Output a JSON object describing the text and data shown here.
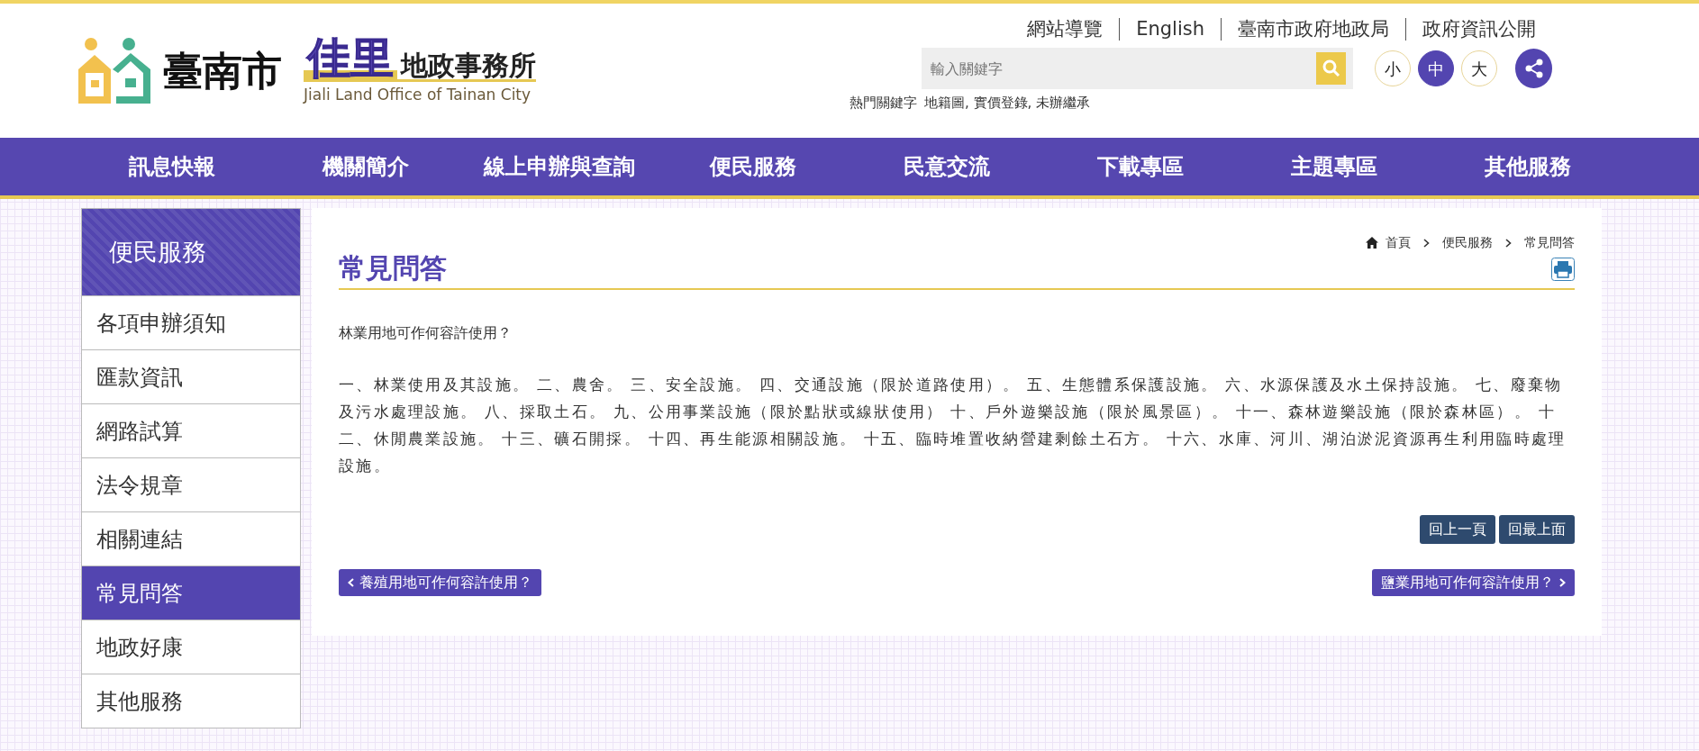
{
  "header": {
    "logo": {
      "city": "臺南市",
      "name_highlight": "佳里",
      "name_rest": "地政事務所",
      "english": "Jiali Land Office of Tainan City"
    },
    "top_links": [
      "網站導覽",
      "English",
      "臺南市政府地政局",
      "政府資訊公開"
    ],
    "search": {
      "placeholder": "輸入關鍵字"
    },
    "font_sizes": [
      {
        "label": "小",
        "selected": false
      },
      {
        "label": "中",
        "selected": true
      },
      {
        "label": "大",
        "selected": false
      }
    ],
    "hot_keywords": {
      "label": "熱門關鍵字",
      "keywords": "地籍圖, 實價登錄, 未辦繼承"
    }
  },
  "nav": [
    "訊息快報",
    "機關簡介",
    "線上申辦與查詢",
    "便民服務",
    "民意交流",
    "下載專區",
    "主題專區",
    "其他服務"
  ],
  "sidebar": {
    "title": "便民服務",
    "items": [
      {
        "label": "各項申辦須知",
        "selected": false
      },
      {
        "label": "匯款資訊",
        "selected": false
      },
      {
        "label": "網路試算",
        "selected": false
      },
      {
        "label": "法令規章",
        "selected": false
      },
      {
        "label": "相關連結",
        "selected": false
      },
      {
        "label": "常見問答",
        "selected": true
      },
      {
        "label": "地政好康",
        "selected": false
      },
      {
        "label": "其他服務",
        "selected": false
      }
    ]
  },
  "breadcrumb": [
    "首頁",
    "便民服務",
    "常見問答"
  ],
  "page_title": "常見問答",
  "question": "林業用地可作何容許使用？",
  "answer": "一、林業使用及其設施。 二、農舍。 三、安全設施。 四、交通設施（限於道路使用）。 五、生態體系保護設施。 六、水源保護及水土保持設施。 七、廢棄物及污水處理設施。 八、採取土石。 九、公用事業設施（限於點狀或線狀使用） 十、戶外遊樂設施（限於風景區）。 十一、森林遊樂設施（限於森林區）。 十二、休閒農業設施。 十三、礦石開採。 十四、再生能源相關設施。 十五、臨時堆置收納營建剩餘土石方。 十六、水庫、河川、湖泊淤泥資源再生利用臨時處理設施。",
  "buttons": [
    "回上一頁",
    "回最上面"
  ],
  "prev_link": "養殖用地可作何容許使用？",
  "next_link": "鹽業用地可作何容許使用？"
}
